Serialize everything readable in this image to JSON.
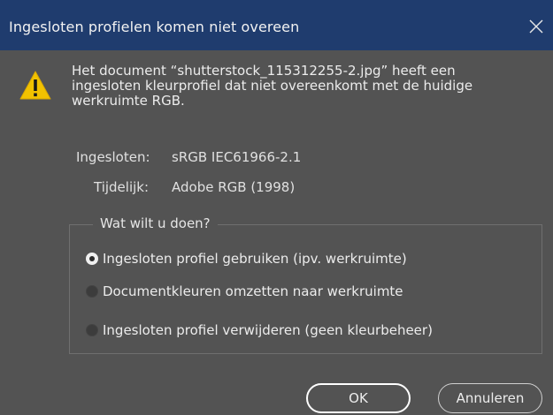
{
  "dialog": {
    "title": "Ingesloten profielen komen niet overeen",
    "message_lines": [
      "Het document “shutterstock_115312255-2.jpg” heeft een",
      "ingesloten kleurprofiel dat niet overeenkomt met de huidige",
      "werkruimte RGB."
    ],
    "embedded": {
      "label": "Ingesloten:",
      "value": "sRGB IEC61966-2.1"
    },
    "temporary": {
      "label": "Tijdelijk:",
      "value": "Adobe RGB (1998)"
    },
    "group": {
      "legend": "Wat wilt u doen?",
      "options": [
        {
          "label": "Ingesloten profiel gebruiken (ipv. werkruimte)",
          "checked": true
        },
        {
          "label": "Documentkleuren omzetten naar werkruimte",
          "checked": false
        },
        {
          "label": "Ingesloten profiel verwijderen (geen kleurbeheer)",
          "checked": false
        }
      ]
    },
    "buttons": {
      "ok": "OK",
      "cancel": "Annuleren"
    }
  },
  "icons": {
    "warning": "warning-triangle-icon",
    "close": "close-icon"
  },
  "colors": {
    "titlebar": "#1f3c6e",
    "background": "#535353",
    "warning": "#f2c200"
  }
}
